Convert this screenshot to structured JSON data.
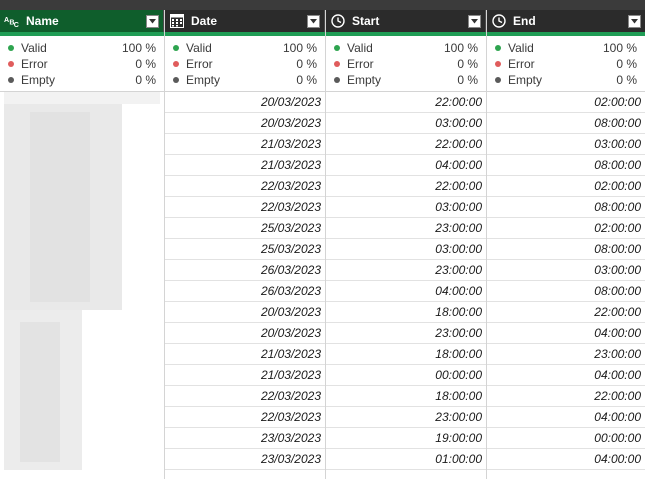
{
  "columns": [
    {
      "key": "name",
      "label": "Name",
      "type_icon": "abc-text-type-icon",
      "profile": [
        {
          "label": "Valid",
          "pct": "100 %",
          "color": "#2ea44f"
        },
        {
          "label": "Error",
          "pct": "0 %",
          "color": "#e05c5c"
        },
        {
          "label": "Empty",
          "pct": "0 %",
          "color": "#5a5a5a"
        }
      ]
    },
    {
      "key": "date",
      "label": "Date",
      "type_icon": "calendar-grid-icon",
      "profile": [
        {
          "label": "Valid",
          "pct": "100 %",
          "color": "#2ea44f"
        },
        {
          "label": "Error",
          "pct": "0 %",
          "color": "#e05c5c"
        },
        {
          "label": "Empty",
          "pct": "0 %",
          "color": "#5a5a5a"
        }
      ],
      "values": [
        "20/03/2023",
        "20/03/2023",
        "21/03/2023",
        "21/03/2023",
        "22/03/2023",
        "22/03/2023",
        "25/03/2023",
        "25/03/2023",
        "26/03/2023",
        "26/03/2023",
        "20/03/2023",
        "20/03/2023",
        "21/03/2023",
        "21/03/2023",
        "22/03/2023",
        "22/03/2023",
        "23/03/2023",
        "23/03/2023"
      ]
    },
    {
      "key": "start",
      "label": "Start",
      "type_icon": "clock-icon",
      "profile": [
        {
          "label": "Valid",
          "pct": "100 %",
          "color": "#2ea44f"
        },
        {
          "label": "Error",
          "pct": "0 %",
          "color": "#e05c5c"
        },
        {
          "label": "Empty",
          "pct": "0 %",
          "color": "#5a5a5a"
        }
      ],
      "values": [
        "22:00:00",
        "03:00:00",
        "22:00:00",
        "04:00:00",
        "22:00:00",
        "03:00:00",
        "23:00:00",
        "03:00:00",
        "23:00:00",
        "04:00:00",
        "18:00:00",
        "23:00:00",
        "18:00:00",
        "00:00:00",
        "18:00:00",
        "23:00:00",
        "19:00:00",
        "01:00:00"
      ]
    },
    {
      "key": "end",
      "label": "End",
      "type_icon": "clock-icon",
      "profile": [
        {
          "label": "Valid",
          "pct": "100 %",
          "color": "#2ea44f"
        },
        {
          "label": "Error",
          "pct": "0 %",
          "color": "#e05c5c"
        },
        {
          "label": "Empty",
          "pct": "0 %",
          "color": "#5a5a5a"
        }
      ],
      "values": [
        "02:00:00",
        "08:00:00",
        "03:00:00",
        "08:00:00",
        "02:00:00",
        "08:00:00",
        "02:00:00",
        "08:00:00",
        "03:00:00",
        "08:00:00",
        "22:00:00",
        "04:00:00",
        "23:00:00",
        "04:00:00",
        "22:00:00",
        "04:00:00",
        "00:00:00",
        "04:00:00"
      ]
    }
  ],
  "colors": {
    "name_header": "#0f5e2c",
    "header": "#2b2b2b",
    "accent": "#1f9d55"
  }
}
